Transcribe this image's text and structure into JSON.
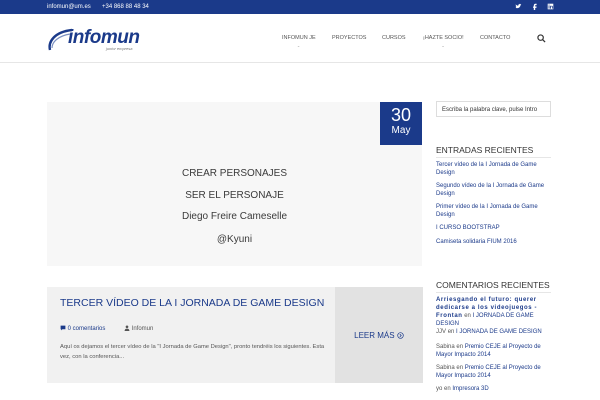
{
  "topbar": {
    "email": "infomun@um.es",
    "phone": "+34 868 88 48 34",
    "social": [
      "twitter-icon",
      "facebook-icon",
      "linkedin-icon"
    ]
  },
  "logo": {
    "text": "infomun",
    "tagline": "junior empresa"
  },
  "nav": {
    "items": [
      "INFOMUN JE",
      "PROYECTOS",
      "CURSOS",
      "¡HAZTE SOCIO!",
      "CONTACTO"
    ]
  },
  "post": {
    "day": "30",
    "month": "May",
    "image_lines": [
      "CREAR PERSONAJES",
      "SER EL PERSONAJE",
      "Diego Freire Cameselle",
      "@Kyuni"
    ],
    "title": "TERCER VÍDEO DE LA I JORNADA DE GAME DESIGN",
    "comments": "0 comentarios",
    "author": "Infomun",
    "excerpt": "Aquí os dejamos el tercer vídeo de la \"I Jornada de Game Design\", pronto tendréis los siguientes. Esta vez, con la conferencia...",
    "read_more": "LEER MÁS"
  },
  "sidebar": {
    "search_placeholder": "Escriba la palabra clave, pulse Intro",
    "recent_posts_title": "ENTRADAS RECIENTES",
    "recent_posts": [
      "Tercer vídeo de la I Jornada de Game Design",
      "Segundo vídeo de la I Jornada de Game Design",
      "Primer vídeo de la I Jornada de Game Design",
      "I CURSO BOOTSTRAP",
      "Camiseta solidaria FIUM 2016"
    ],
    "recent_comments_title": "COMENTARIOS RECIENTES",
    "recent_comments": [
      {
        "author": "Arriesgando el futuro: querer dedicarse a los videojuegos - Frontan",
        "on": "en",
        "post": "I JORNADA DE GAME DESIGN"
      },
      {
        "author": "JJV",
        "on": "en",
        "post": "I JORNADA DE GAME DESIGN"
      },
      {
        "author": "Sabina",
        "on": "en",
        "post": "Premio CEJE al Proyecto de Mayor Impacto 2014"
      },
      {
        "author": "Sabina",
        "on": "en",
        "post": "Premio CEJE al Proyecto de Mayor Impacto 2014"
      },
      {
        "author": "yo",
        "on": "en",
        "post": "Impresora 3D"
      }
    ]
  },
  "colors": {
    "brand": "#1b3a8a",
    "background": "#ffffff",
    "panel": "#f1f1f1"
  }
}
